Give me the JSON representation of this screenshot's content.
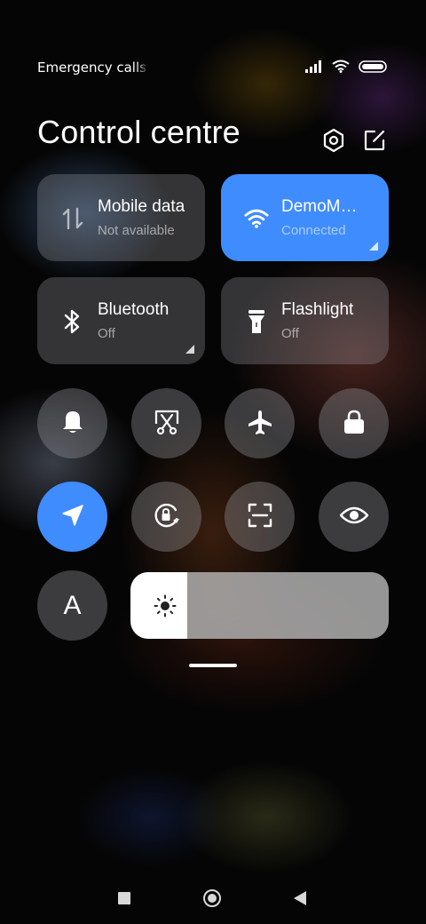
{
  "status_bar": {
    "carrier_text": "Emergency calls only",
    "icons": [
      "signal-icon",
      "wifi-icon",
      "battery-icon"
    ]
  },
  "header": {
    "title": "Control centre",
    "buttons": [
      "settings-icon",
      "edit-icon"
    ]
  },
  "tiles": [
    {
      "name": "mobile-data",
      "title": "Mobile data",
      "subtitle": "Not available",
      "active": false
    },
    {
      "name": "wifi",
      "title": "DemoModeWiFi",
      "subtitle": "Connected",
      "active": true
    },
    {
      "name": "bluetooth",
      "title": "Bluetooth",
      "subtitle": "Off",
      "active": false
    },
    {
      "name": "flashlight",
      "title": "Flashlight",
      "subtitle": "Off",
      "active": false
    }
  ],
  "toggles": [
    {
      "name": "sound",
      "icon": "bell-icon",
      "active": false
    },
    {
      "name": "screenshot",
      "icon": "scissors-icon",
      "active": false
    },
    {
      "name": "airplane-mode",
      "icon": "airplane-icon",
      "active": false
    },
    {
      "name": "lock-screen",
      "icon": "lock-icon",
      "active": false
    },
    {
      "name": "location",
      "icon": "location-arrow-icon",
      "active": true
    },
    {
      "name": "rotation-lock",
      "icon": "rotation-lock-icon",
      "active": false
    },
    {
      "name": "scanner",
      "icon": "scan-icon",
      "active": false
    },
    {
      "name": "reading-mode",
      "icon": "eye-icon",
      "active": false
    },
    {
      "name": "auto-brightness",
      "icon": "auto-brightness-icon",
      "label": "A",
      "active": false
    }
  ],
  "brightness": {
    "level": 0.22,
    "icon": "sun-icon"
  },
  "navigation": [
    "recents-icon",
    "home-icon",
    "back-icon"
  ],
  "colors": {
    "accent": "#3f8cff",
    "tile_inactive": "#5c5c60",
    "background": "#050505"
  }
}
